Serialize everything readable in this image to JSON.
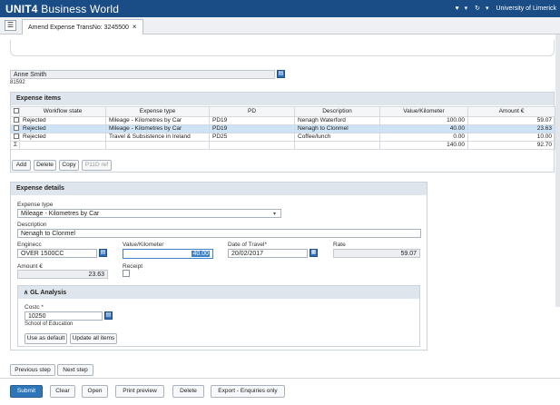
{
  "app": {
    "brand_bold": "UNIT4",
    "brand_rest": " Business World",
    "user_org": "University of Limerick",
    "heart_icon": "♥",
    "help_icon": "↻"
  },
  "tab": {
    "label": "Amend Expense TransNo: 3245500",
    "close": "×"
  },
  "employee": {
    "name": "Anne Smith",
    "id": "81592"
  },
  "expense_items": {
    "title": "Expense items",
    "columns": [
      "Workflow state",
      "Expense type",
      "PD",
      "Description",
      "Value/Kilometer",
      "Amount €"
    ],
    "rows": [
      {
        "state": "Rejected",
        "type": "Mileage - Kilometres by Car",
        "pd": "PD19",
        "desc": "Nenagh Waterford",
        "value": "100.00",
        "amount": "59.07"
      },
      {
        "state": "Rejected",
        "type": "Mileage - Kilometres by Car",
        "pd": "PD19",
        "desc": "Nenagh to Clonmel",
        "value": "40.00",
        "amount": "23.63"
      },
      {
        "state": "Rejected",
        "type": "Travel & Subsistence in Ireland",
        "pd": "PD25",
        "desc": "Coffee/lunch",
        "value": "0.00",
        "amount": "10.00"
      }
    ],
    "sum_symbol": "Σ",
    "total_value": "140.00",
    "total_amount": "92.70",
    "buttons": {
      "add": "Add",
      "delete": "Delete",
      "copy": "Copy",
      "p11d": "P11D ref"
    }
  },
  "expense_details": {
    "title": "Expense details",
    "expense_type_label": "Expense type",
    "expense_type_value": "Mileage - Kilometres by Car",
    "description_label": "Description",
    "description_value": "Nenagh to Clonmel",
    "enginecc_label": "Enginecc",
    "enginecc_value": "OVER 1500CC",
    "value_km_label": "Value/Kilometer",
    "value_km_value": "40.00",
    "date_label": "Date of Travel*",
    "date_value": "20/02/2017",
    "rate_label": "Rate",
    "rate_value": "59.07",
    "amount_label": "Amount €",
    "amount_value": "23.63",
    "receipt_label": "Receipt"
  },
  "gl": {
    "title": "GL Analysis",
    "costc_label": "Costc *",
    "costc_value": "10250",
    "costc_desc": "School of Education",
    "use_default": "Use as default",
    "update_all": "Update all items"
  },
  "steps": {
    "previous": "Previous step",
    "next": "Next step"
  },
  "actions": {
    "submit": "Submit",
    "clear": "Clear",
    "open": "Open",
    "print_preview": "Print preview",
    "delete": "Delete",
    "export": "Export - Enquiries only"
  }
}
